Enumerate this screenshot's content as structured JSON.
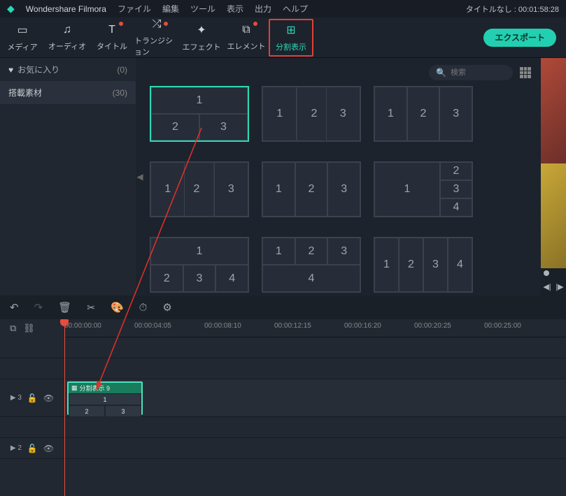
{
  "app": {
    "name": "Wondershare Filmora",
    "project_label": "タイトルなし : 00:01:58:28"
  },
  "menu": [
    "ファイル",
    "編集",
    "ツール",
    "表示",
    "出力",
    "ヘルプ"
  ],
  "tabs": [
    {
      "label": "メディア",
      "icon": "▭"
    },
    {
      "label": "オーディオ",
      "icon": "♫"
    },
    {
      "label": "タイトル",
      "icon": "T",
      "dot": true
    },
    {
      "label": "トランジション",
      "icon": "⤮",
      "dot": true
    },
    {
      "label": "エフェクト",
      "icon": "✦"
    },
    {
      "label": "エレメント",
      "icon": "⧉",
      "dot": true
    },
    {
      "label": "分割表示",
      "icon": "⊞",
      "active": true
    }
  ],
  "export_label": "エクスポート",
  "sidebar": {
    "favorites_label": "お気に入り",
    "favorites_count": "(0)",
    "preset_label": "搭載素材",
    "preset_count": "(30)"
  },
  "search": {
    "placeholder": "検索"
  },
  "timeline": {
    "timecodes": [
      "00:00:00:00",
      "00:00:04:05",
      "00:00:08:10",
      "00:00:12:15",
      "00:00:16:20",
      "00:00:20:25",
      "00:00:25:00"
    ],
    "clip_label": "分割表示 9",
    "track3_label": "▶ 3",
    "track2_label": "▶ 2"
  },
  "cells": {
    "c1": "1",
    "c2": "2",
    "c3": "3",
    "c4": "4"
  }
}
